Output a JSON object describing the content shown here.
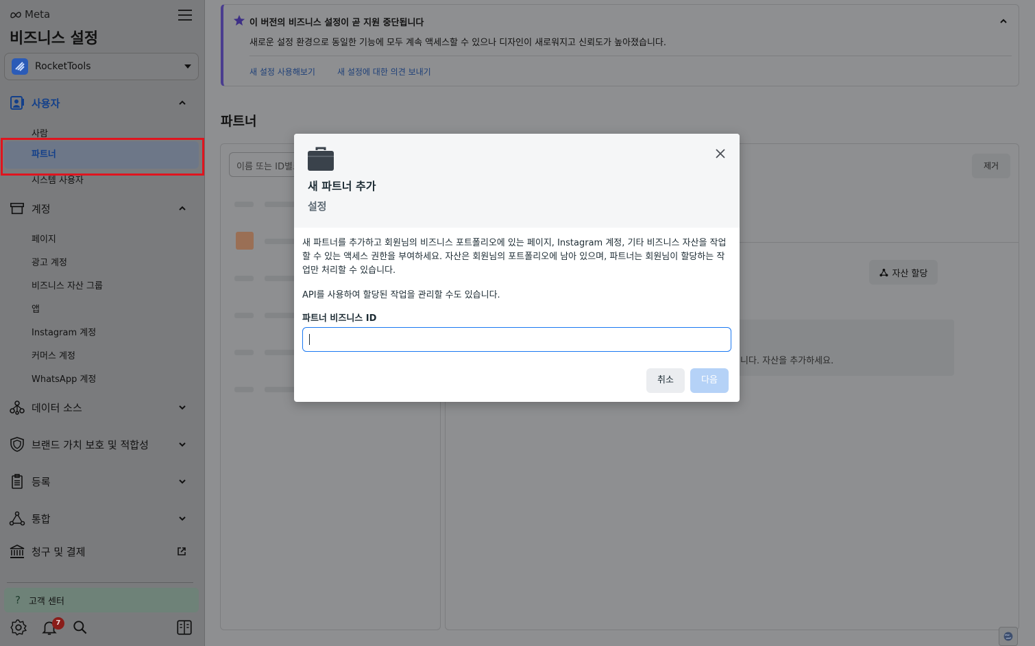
{
  "sidebar": {
    "brand": "Meta",
    "title": "비즈니스 설정",
    "account": {
      "name": "RocketTools"
    },
    "groups": {
      "users": {
        "label": "사용자",
        "items": [
          "사람",
          "파트너",
          "시스템 사용자"
        ]
      },
      "accounts": {
        "label": "계정",
        "items": [
          "페이지",
          "광고 계정",
          "비즈니스 자산 그룹",
          "앱",
          "Instagram 계정",
          "커머스 계정",
          "WhatsApp 계정"
        ]
      },
      "data_sources": {
        "label": "데이터 소스"
      },
      "brand_safety": {
        "label": "브랜드 가치 보호 및 적합성"
      },
      "registration": {
        "label": "등록"
      },
      "integrations": {
        "label": "통합"
      },
      "billing": {
        "label": "청구 및 결제"
      }
    },
    "help": {
      "label": "고객 센터"
    },
    "notifications_count": "7"
  },
  "notice": {
    "title": "이 버전의 비즈니스 설정이 곧 지원 중단됩니다",
    "body": "새로운 설정 환경으로 동일한 기능에 모두 계속 액세스할 수 있으나 디자인이 새로워지고 신뢰도가 높아졌습니다.",
    "link_try": "새 설정 사용해보기",
    "link_feedback": "새 설정에 대한 의견 보내기"
  },
  "main": {
    "page_title": "파트너",
    "search_placeholder": "이름 또는 ID별로",
    "remove_label": "제거",
    "assign_label": "자산 할당",
    "empty_text": "니다. 자산을 추가하세요."
  },
  "modal": {
    "title": "새 파트너 추가",
    "subtitle": "설정",
    "description": "새 파트너를 추가하고 회원님의 비즈니스 포트폴리오에 있는 페이지, Instagram 계정, 기타 비즈니스 자산을 작업할 수 있는 액세스 권한을 부여하세요. 자산은 회원님의 포트폴리오에 남아 있으며, 파트너는 회원님이 할당하는 작업만 처리할 수 있습니다.",
    "api_note": "API를 사용하여 할당된 작업을 관리할 수도 있습니다.",
    "field_label": "파트너 비즈니스 ID",
    "field_value": "",
    "cancel_label": "취소",
    "next_label": "다음"
  },
  "colors": {
    "primary": "#1877f2",
    "next_disabled": "#b5d2f7",
    "highlight": "#e0141e",
    "notice_accent": "#4a3d8f"
  }
}
